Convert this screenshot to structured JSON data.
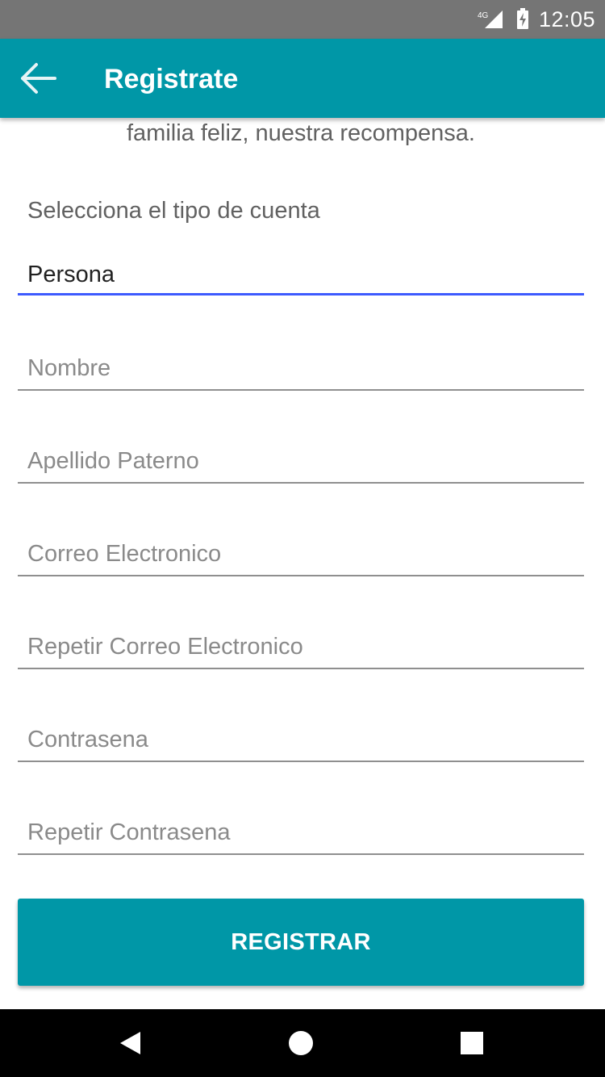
{
  "status_bar": {
    "network_label": "4G",
    "clock": "12:05"
  },
  "app_bar": {
    "back_icon": "arrow-back-icon",
    "title": "Registrate"
  },
  "form": {
    "tagline": "familia feliz, nuestra recompensa.",
    "account_type_label": "Selecciona el tipo de cuenta",
    "account_type_value": "Persona",
    "fields": [
      {
        "placeholder": "Nombre",
        "value": ""
      },
      {
        "placeholder": "Apellido Paterno",
        "value": ""
      },
      {
        "placeholder": "Correo Electronico",
        "value": ""
      },
      {
        "placeholder": "Repetir Correo Electronico",
        "value": ""
      },
      {
        "placeholder": "Contrasena",
        "value": ""
      },
      {
        "placeholder": "Repetir Contrasena",
        "value": ""
      }
    ],
    "submit_label": "REGISTRAR"
  },
  "nav_bar": {
    "icons": [
      "back-triangle-icon",
      "home-circle-icon",
      "recents-square-icon"
    ]
  },
  "colors": {
    "status_bar": "#757575",
    "primary": "#0097a7",
    "spinner_underline": "#3d5afe",
    "field_underline": "#8f8f8f",
    "nav_bar": "#000000"
  }
}
